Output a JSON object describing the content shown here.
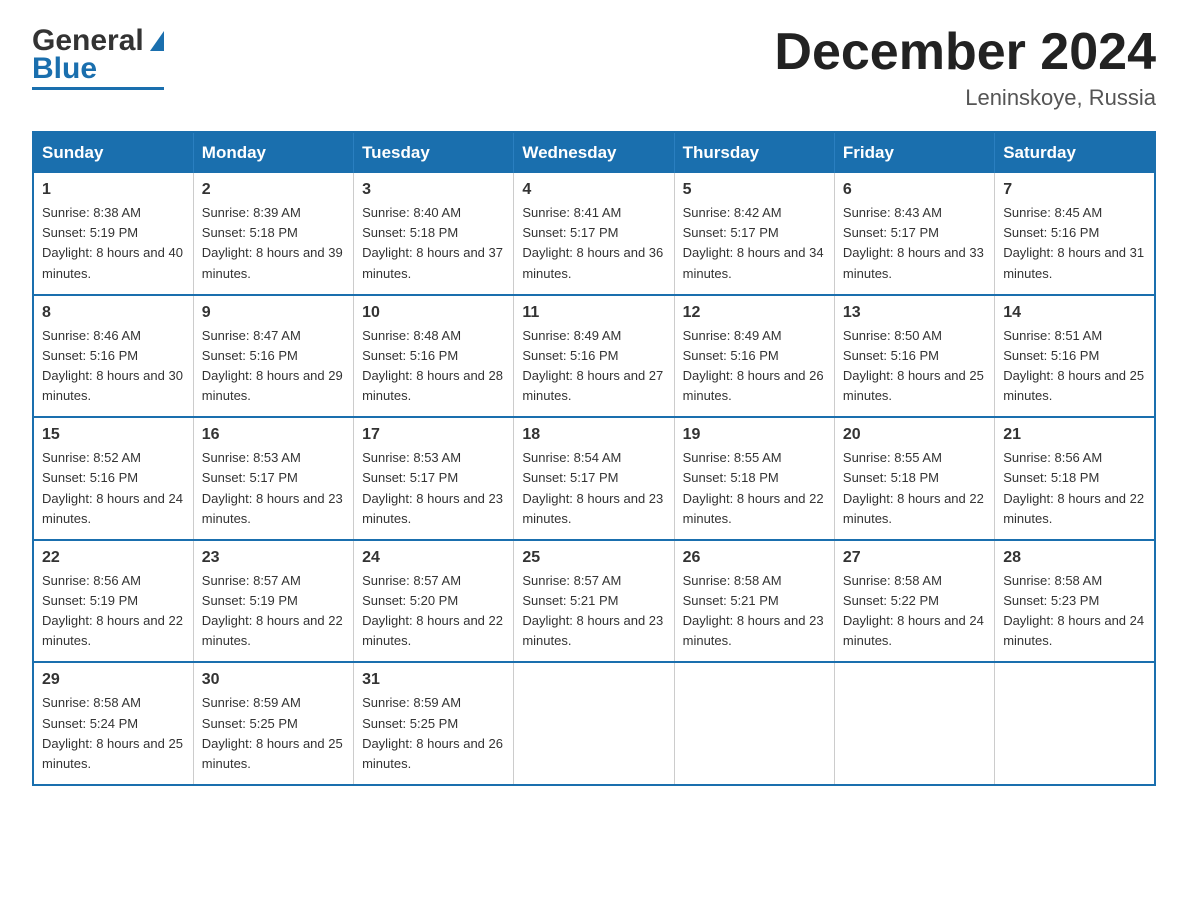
{
  "header": {
    "logo_line1": "General",
    "logo_line2": "Blue",
    "month_title": "December 2024",
    "location": "Leninskoye, Russia"
  },
  "calendar": {
    "days_of_week": [
      "Sunday",
      "Monday",
      "Tuesday",
      "Wednesday",
      "Thursday",
      "Friday",
      "Saturday"
    ],
    "weeks": [
      [
        {
          "day": "1",
          "sunrise": "8:38 AM",
          "sunset": "5:19 PM",
          "daylight": "8 hours and 40 minutes."
        },
        {
          "day": "2",
          "sunrise": "8:39 AM",
          "sunset": "5:18 PM",
          "daylight": "8 hours and 39 minutes."
        },
        {
          "day": "3",
          "sunrise": "8:40 AM",
          "sunset": "5:18 PM",
          "daylight": "8 hours and 37 minutes."
        },
        {
          "day": "4",
          "sunrise": "8:41 AM",
          "sunset": "5:17 PM",
          "daylight": "8 hours and 36 minutes."
        },
        {
          "day": "5",
          "sunrise": "8:42 AM",
          "sunset": "5:17 PM",
          "daylight": "8 hours and 34 minutes."
        },
        {
          "day": "6",
          "sunrise": "8:43 AM",
          "sunset": "5:17 PM",
          "daylight": "8 hours and 33 minutes."
        },
        {
          "day": "7",
          "sunrise": "8:45 AM",
          "sunset": "5:16 PM",
          "daylight": "8 hours and 31 minutes."
        }
      ],
      [
        {
          "day": "8",
          "sunrise": "8:46 AM",
          "sunset": "5:16 PM",
          "daylight": "8 hours and 30 minutes."
        },
        {
          "day": "9",
          "sunrise": "8:47 AM",
          "sunset": "5:16 PM",
          "daylight": "8 hours and 29 minutes."
        },
        {
          "day": "10",
          "sunrise": "8:48 AM",
          "sunset": "5:16 PM",
          "daylight": "8 hours and 28 minutes."
        },
        {
          "day": "11",
          "sunrise": "8:49 AM",
          "sunset": "5:16 PM",
          "daylight": "8 hours and 27 minutes."
        },
        {
          "day": "12",
          "sunrise": "8:49 AM",
          "sunset": "5:16 PM",
          "daylight": "8 hours and 26 minutes."
        },
        {
          "day": "13",
          "sunrise": "8:50 AM",
          "sunset": "5:16 PM",
          "daylight": "8 hours and 25 minutes."
        },
        {
          "day": "14",
          "sunrise": "8:51 AM",
          "sunset": "5:16 PM",
          "daylight": "8 hours and 25 minutes."
        }
      ],
      [
        {
          "day": "15",
          "sunrise": "8:52 AM",
          "sunset": "5:16 PM",
          "daylight": "8 hours and 24 minutes."
        },
        {
          "day": "16",
          "sunrise": "8:53 AM",
          "sunset": "5:17 PM",
          "daylight": "8 hours and 23 minutes."
        },
        {
          "day": "17",
          "sunrise": "8:53 AM",
          "sunset": "5:17 PM",
          "daylight": "8 hours and 23 minutes."
        },
        {
          "day": "18",
          "sunrise": "8:54 AM",
          "sunset": "5:17 PM",
          "daylight": "8 hours and 23 minutes."
        },
        {
          "day": "19",
          "sunrise": "8:55 AM",
          "sunset": "5:18 PM",
          "daylight": "8 hours and 22 minutes."
        },
        {
          "day": "20",
          "sunrise": "8:55 AM",
          "sunset": "5:18 PM",
          "daylight": "8 hours and 22 minutes."
        },
        {
          "day": "21",
          "sunrise": "8:56 AM",
          "sunset": "5:18 PM",
          "daylight": "8 hours and 22 minutes."
        }
      ],
      [
        {
          "day": "22",
          "sunrise": "8:56 AM",
          "sunset": "5:19 PM",
          "daylight": "8 hours and 22 minutes."
        },
        {
          "day": "23",
          "sunrise": "8:57 AM",
          "sunset": "5:19 PM",
          "daylight": "8 hours and 22 minutes."
        },
        {
          "day": "24",
          "sunrise": "8:57 AM",
          "sunset": "5:20 PM",
          "daylight": "8 hours and 22 minutes."
        },
        {
          "day": "25",
          "sunrise": "8:57 AM",
          "sunset": "5:21 PM",
          "daylight": "8 hours and 23 minutes."
        },
        {
          "day": "26",
          "sunrise": "8:58 AM",
          "sunset": "5:21 PM",
          "daylight": "8 hours and 23 minutes."
        },
        {
          "day": "27",
          "sunrise": "8:58 AM",
          "sunset": "5:22 PM",
          "daylight": "8 hours and 24 minutes."
        },
        {
          "day": "28",
          "sunrise": "8:58 AM",
          "sunset": "5:23 PM",
          "daylight": "8 hours and 24 minutes."
        }
      ],
      [
        {
          "day": "29",
          "sunrise": "8:58 AM",
          "sunset": "5:24 PM",
          "daylight": "8 hours and 25 minutes."
        },
        {
          "day": "30",
          "sunrise": "8:59 AM",
          "sunset": "5:25 PM",
          "daylight": "8 hours and 25 minutes."
        },
        {
          "day": "31",
          "sunrise": "8:59 AM",
          "sunset": "5:25 PM",
          "daylight": "8 hours and 26 minutes."
        },
        null,
        null,
        null,
        null
      ]
    ]
  }
}
